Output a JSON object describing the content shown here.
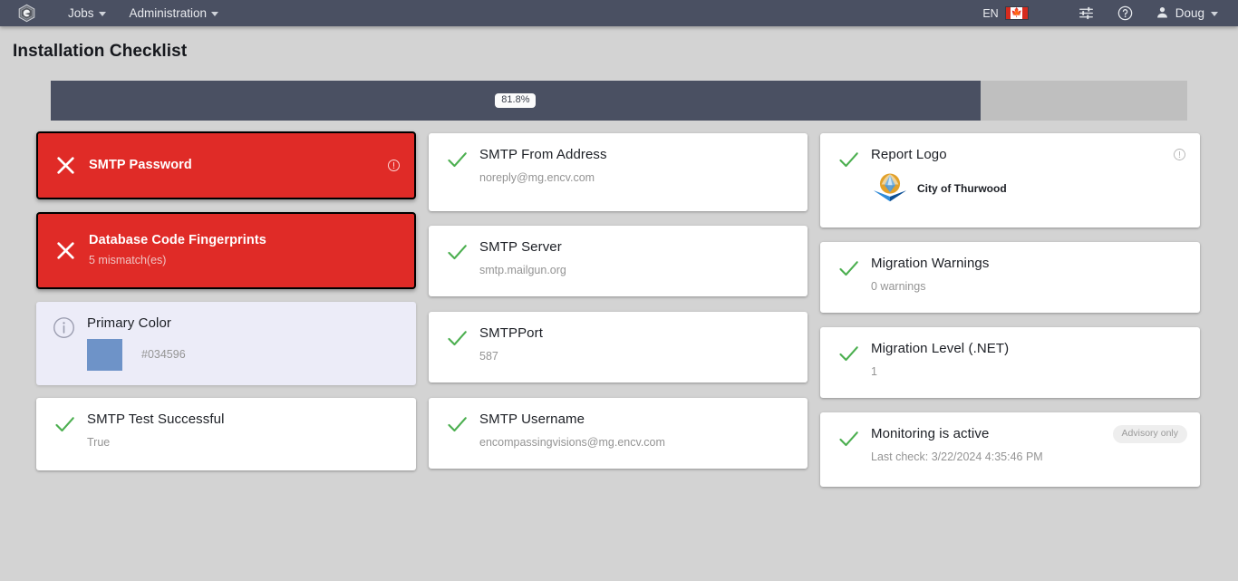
{
  "navbar": {
    "brand_icon": "hexagon-logo-icon",
    "menus": [
      {
        "label": "Jobs",
        "icon": "chevron-down-icon"
      },
      {
        "label": "Administration",
        "icon": "chevron-down-icon"
      }
    ],
    "language": "EN",
    "flag": "canada-flag-icon",
    "settings_icon": "sliders-icon",
    "help_icon": "question-circle-icon",
    "user_icon": "user-icon",
    "user_name": "Doug",
    "user_caret": "chevron-down-icon"
  },
  "page": {
    "title": "Installation Checklist"
  },
  "progress": {
    "percent_label": "81.8%",
    "percent_value": 81.8,
    "fill_color": "#4a5062",
    "track_color": "#bfbfbf"
  },
  "columns": [
    {
      "name": "column-one",
      "cards": [
        {
          "id": "smtp-password",
          "status": "fail",
          "icon": "x-icon",
          "title": "SMTP Password",
          "subtitle": "",
          "corner_icon": "info-circle-icon"
        },
        {
          "id": "database-code-fingerprints",
          "status": "fail",
          "icon": "x-icon",
          "title": "Database Code Fingerprints",
          "subtitle": "5 mismatch(es)"
        },
        {
          "id": "primary-color",
          "status": "info",
          "icon": "info-circle-icon",
          "title": "Primary Color",
          "swatch_hex": "#034596",
          "swatch_color": "#6e93c8"
        },
        {
          "id": "smtp-test-successful",
          "status": "pass",
          "icon": "check-icon",
          "title": "SMTP Test Successful",
          "subtitle": "True"
        }
      ]
    },
    {
      "name": "column-two",
      "cards": [
        {
          "id": "smtp-from-address",
          "status": "pass",
          "icon": "check-icon",
          "title": "SMTP From Address",
          "subtitle": "noreply@mg.encv.com"
        },
        {
          "id": "smtp-server",
          "status": "pass",
          "icon": "check-icon",
          "title": "SMTP Server",
          "subtitle": "smtp.mailgun.org"
        },
        {
          "id": "smtp-port",
          "status": "pass",
          "icon": "check-icon",
          "title": "SMTPPort",
          "subtitle": "587"
        },
        {
          "id": "smtp-username",
          "status": "pass",
          "icon": "check-icon",
          "title": "SMTP Username",
          "subtitle": "encompassingvisions@mg.encv.com"
        }
      ]
    },
    {
      "name": "column-three",
      "cards": [
        {
          "id": "report-logo",
          "status": "pass",
          "icon": "check-icon",
          "title": "Report Logo",
          "logo_name": "City of Thurwood",
          "logo_icon": "city-of-thurwood-logo-icon",
          "corner_icon": "info-circle-icon"
        },
        {
          "id": "migration-warnings",
          "status": "pass",
          "icon": "check-icon",
          "title": "Migration Warnings",
          "subtitle": "0 warnings"
        },
        {
          "id": "migration-level-net",
          "status": "pass",
          "icon": "check-icon",
          "title": "Migration Level (.NET)",
          "subtitle": "1"
        },
        {
          "id": "monitoring-is-active",
          "status": "pass",
          "icon": "check-icon",
          "title": "Monitoring is active",
          "subtitle": "Last check: 3/22/2024 4:35:46 PM",
          "badge": "Advisory only"
        }
      ]
    }
  ]
}
